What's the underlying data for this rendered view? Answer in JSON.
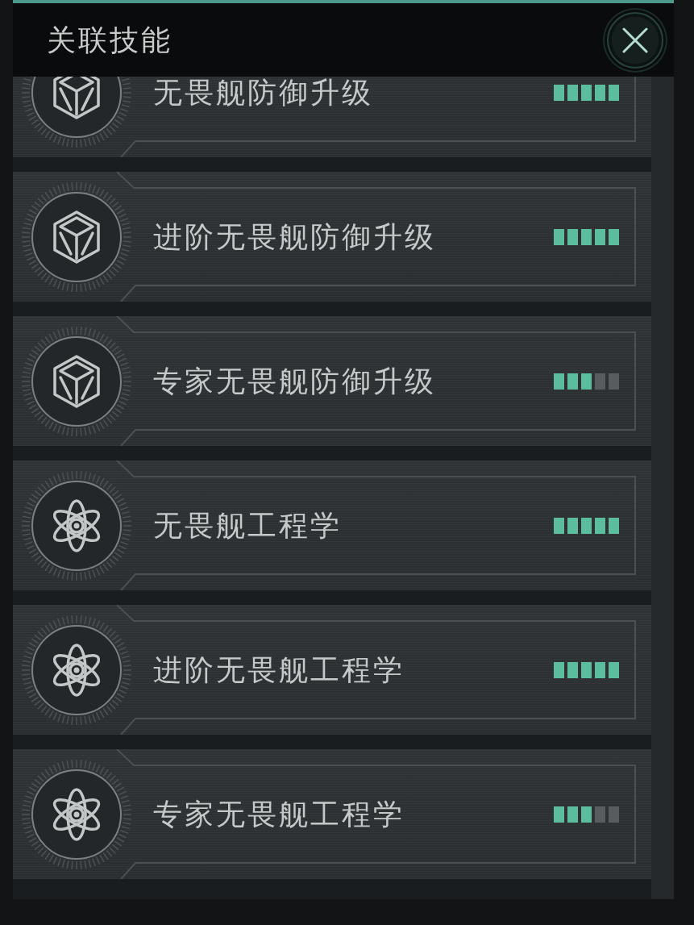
{
  "header": {
    "title": "关联技能"
  },
  "skills": [
    {
      "name": "无畏舰防御升级",
      "kind": "cube",
      "stars": 5
    },
    {
      "name": "进阶无畏舰防御升级",
      "kind": "cube",
      "stars": 5
    },
    {
      "name": "专家无畏舰防御升级",
      "kind": "cube",
      "stars": 3
    },
    {
      "name": "无畏舰工程学",
      "kind": "atom",
      "stars": 5
    },
    {
      "name": "进阶无畏舰工程学",
      "kind": "atom",
      "stars": 5
    },
    {
      "name": "专家无畏舰工程学",
      "kind": "atom",
      "stars": 3
    }
  ]
}
